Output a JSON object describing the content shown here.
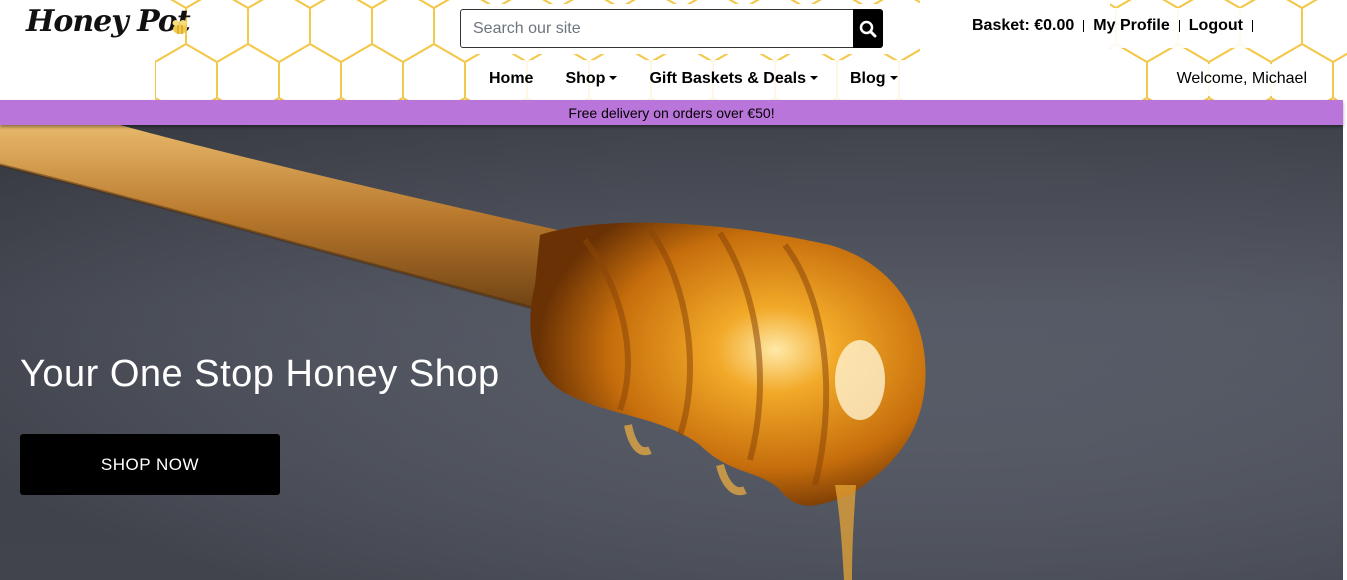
{
  "brand": {
    "logo_text": "Honey Pot",
    "accent_color": "#f2c94c",
    "banner_color": "#b975d9"
  },
  "search": {
    "placeholder": "Search our site",
    "value": "",
    "icon": "search-icon"
  },
  "account": {
    "basket_label": "Basket: €0.00",
    "profile_label": "My Profile",
    "logout_label": "Logout"
  },
  "nav": {
    "items": [
      {
        "label": "Home",
        "dropdown": false
      },
      {
        "label": "Shop",
        "dropdown": true
      },
      {
        "label": "Gift Baskets & Deals",
        "dropdown": true
      },
      {
        "label": "Blog",
        "dropdown": true
      }
    ]
  },
  "welcome": {
    "text": "Welcome, Michael"
  },
  "banner": {
    "text": "Free delivery on orders over €50!"
  },
  "hero": {
    "title": "Your One Stop Honey Shop",
    "cta_label": "SHOP NOW"
  }
}
